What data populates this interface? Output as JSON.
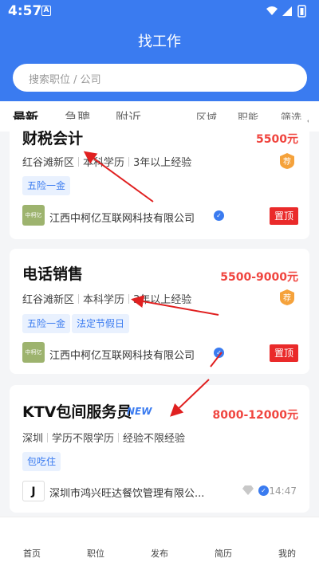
{
  "status": {
    "time": "4:57",
    "notif": "A"
  },
  "header": {
    "title": "找工作",
    "search_placeholder": "搜索职位 / 公司"
  },
  "tabs": [
    "最新",
    "急聘",
    "附近"
  ],
  "filters": [
    "区域",
    "职能",
    "筛选"
  ],
  "jobs": [
    {
      "title": "财税会计",
      "salary": "5500元",
      "meta": [
        "红谷滩新区",
        "本科学历",
        "3年以上经验"
      ],
      "tags": [
        "五险一金"
      ],
      "logo_text": "中柯亿",
      "company": "江西中柯亿互联网科技有限公司",
      "badge": "置顶",
      "rec": "荐"
    },
    {
      "title": "电话销售",
      "salary": "5500-9000元",
      "meta": [
        "红谷滩新区",
        "本科学历",
        "3年以上经验"
      ],
      "tags": [
        "五险一金",
        "法定节假日"
      ],
      "logo_text": "中柯亿",
      "company": "江西中柯亿互联网科技有限公司",
      "badge": "置顶",
      "rec": "荐"
    },
    {
      "title": "KTV包间服务员",
      "new_label": "NEW",
      "salary": "8000-12000元",
      "meta": [
        "深圳",
        "学历不限学历",
        "经验不限经验"
      ],
      "tags": [
        "包吃住"
      ],
      "logo_text": "J",
      "company": "深圳市鸿兴旺达餐饮管理有限公...",
      "time": "14:47"
    }
  ],
  "bottom_nav": [
    "首页",
    "职位",
    "发布",
    "简历",
    "我的"
  ],
  "colors": {
    "primary": "#3a7bf0",
    "salary": "#f0453f",
    "pin": "#ea2a2a",
    "rec": "#f5a23b",
    "arrow": "#e02020"
  }
}
